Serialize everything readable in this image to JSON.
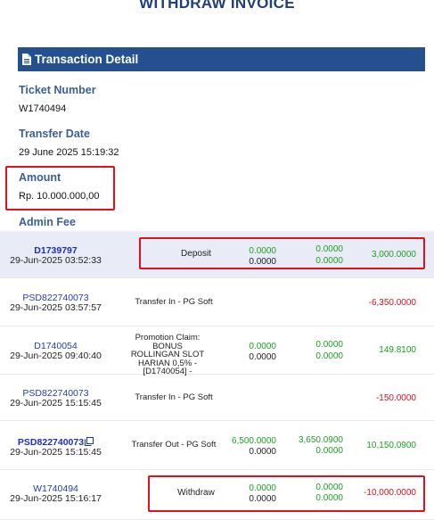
{
  "page": {
    "title": "WITHDRAW INVOICE"
  },
  "section": {
    "title": "Transaction Detail",
    "icon": "document-icon"
  },
  "fields": {
    "ticket_label": "Ticket Number",
    "ticket_value": "W1740494",
    "date_label": "Transfer Date",
    "date_value": "29 June 2025 15:19:32",
    "amount_label": "Amount",
    "amount_value": "Rp. 10.000.000,00",
    "fee_label": "Admin Fee"
  },
  "colors": {
    "accent": "#24508f",
    "highlight_border": "#e0101c",
    "positive": "#1ea020",
    "negative": "#d8141c"
  },
  "transactions": [
    {
      "id": "D1739797",
      "datetime": "29-Jun-2025 03:52:33",
      "description": "Deposit",
      "col1_top": "0.0000",
      "col1_bottom": "0.0000",
      "col2_top": "0.0000",
      "col2_bottom": "0.0000",
      "amount": "3,000.0000"
    },
    {
      "id": "PSD822740073",
      "datetime": "29-Jun-2025 03:57:57",
      "description": "Transfer In - PG Soft",
      "amount": "-6,350.0000"
    },
    {
      "id": "D1740054",
      "datetime": "29-Jun-2025 09:40:40",
      "description": "Promotion Claim: BONUS ROLLINGAN SLOT HARIAN 0,5% - [D1740054] -",
      "col1_top": "0.0000",
      "col1_bottom": "0.0000",
      "col2_top": "0.0000",
      "col2_bottom": "0.0000",
      "amount": "149.8100"
    },
    {
      "id": "PSD822740073",
      "datetime": "29-Jun-2025 15:15:45",
      "description": "Transfer In - PG Soft",
      "amount": "-150.0000"
    },
    {
      "id": "PSD822740073",
      "datetime": "29-Jun-2025 15:15:45",
      "description": "Transfer Out - PG Soft",
      "col1_top": "6,500.0000",
      "col1_bottom": "0.0000",
      "col2_top": "3,650.0900",
      "col2_bottom": "0.0000",
      "amount": "10,150.0900"
    },
    {
      "id": "W1740494",
      "datetime": "29-Jun-2025 15:16:17",
      "description": "Withdraw",
      "col1_top": "0.0000",
      "col1_bottom": "0.0000",
      "col2_top": "0.0000",
      "col2_bottom": "0.0000",
      "amount": "-10,000.0000"
    }
  ]
}
